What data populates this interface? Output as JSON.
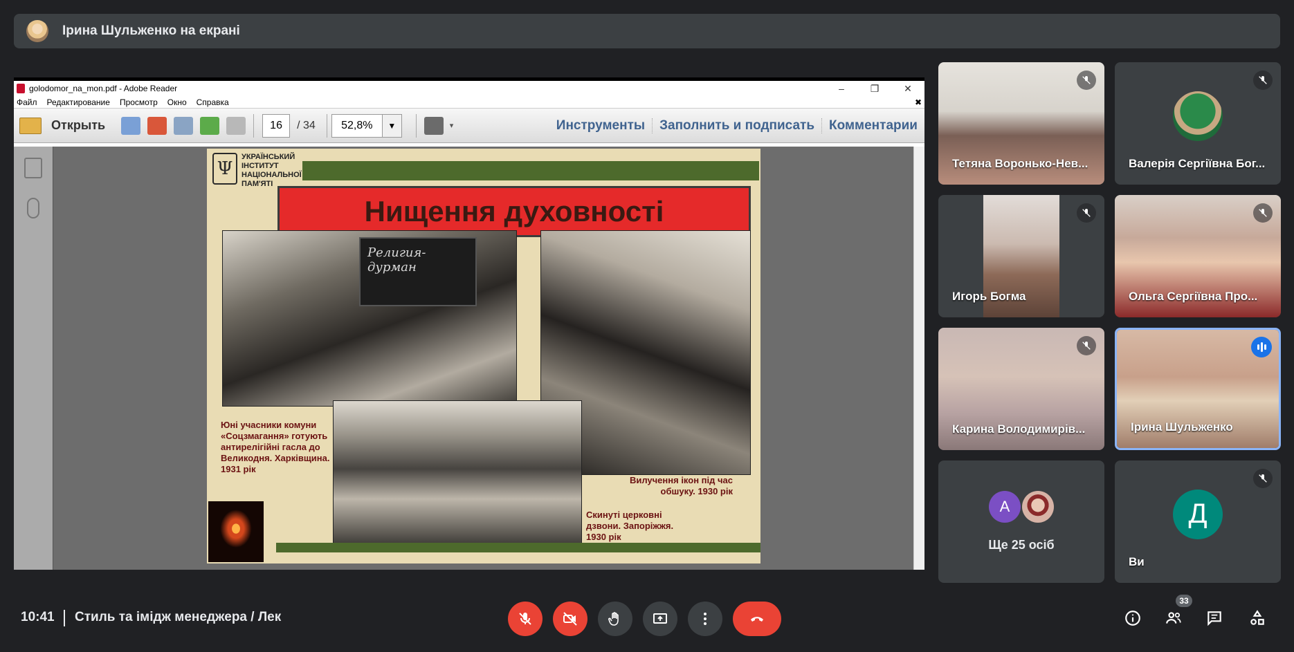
{
  "presenter_banner": {
    "text": "Ірина Шульженко на екрані"
  },
  "reader": {
    "window_title": "golodomor_na_mon.pdf - Adobe Reader",
    "menu": [
      "Файл",
      "Редактирование",
      "Просмотр",
      "Окно",
      "Справка"
    ],
    "open_label": "Открыть",
    "page_current": "16",
    "page_total": "/ 34",
    "zoom": "52,8%",
    "links": [
      "Инструменты",
      "Заполнить и подписать",
      "Комментарии"
    ]
  },
  "slide": {
    "institute": "УКРАЇНСЬКИЙ ІНСТИТУТ НАЦІОНАЛЬНОЇ ПАМ'ЯТІ",
    "title": "Нищення духовності",
    "board_text": "Религия-дурман",
    "caption_1": "Юні учасники комуни «Соцзмагання» готують антирелігійні гасла до Великодня. Харківщина. 1931 рік",
    "caption_2": "Вилучення ікон під час обшуку. 1930 рік",
    "caption_3": "Скинуті церковні дзвони. Запоріжжя. 1930 рік"
  },
  "participants": [
    {
      "name": "Тетяна Воронько-Нев..."
    },
    {
      "name": "Валерія Сергіївна Бог..."
    },
    {
      "name": "Игорь Богма"
    },
    {
      "name": "Ольга Сергіївна Про..."
    },
    {
      "name": "Карина Володимирів..."
    },
    {
      "name": "Ірина Шульженко"
    },
    {
      "name": "Ще 25 осіб",
      "avatar_letter": "А"
    },
    {
      "name": "Ви",
      "avatar_letter": "Д"
    }
  ],
  "bottom": {
    "time": "10:41",
    "meeting": "Стиль та імідж менеджера / Лек",
    "participant_count": "33"
  },
  "colors": {
    "background": "#202124",
    "tile": "#3c4043",
    "danger": "#ea4335",
    "accent": "#8ab4f8"
  }
}
